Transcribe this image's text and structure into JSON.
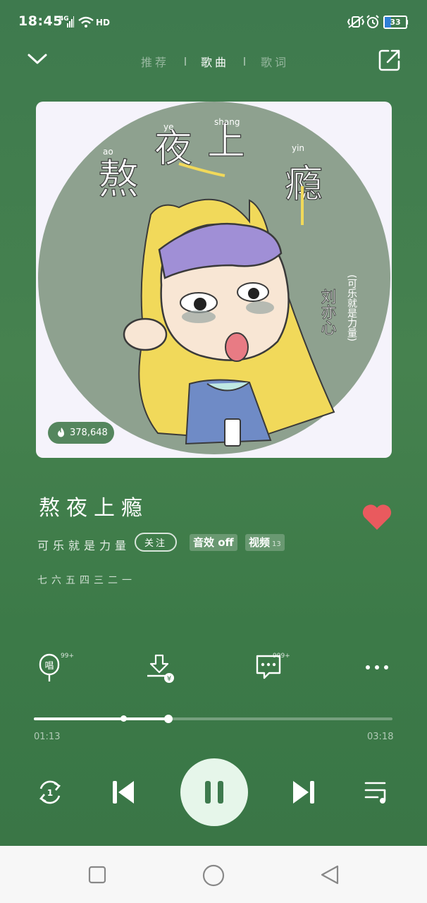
{
  "status_bar": {
    "time": "18:45",
    "network": "4G",
    "wifi_badge": "HD",
    "battery": "33"
  },
  "top_nav": {
    "tabs": [
      {
        "label": "推荐",
        "active": false
      },
      {
        "label": "歌曲",
        "active": true
      },
      {
        "label": "歌词",
        "active": false
      }
    ]
  },
  "cover": {
    "heat_count": "378,648"
  },
  "song": {
    "title": "熬夜上瘾",
    "artist": "可乐就是力量",
    "follow_label": "关注",
    "sound_effect_label": "音效 off",
    "video_label": "视频",
    "video_count": "13",
    "lyric_line": "七六五四三二一"
  },
  "actions": {
    "sing_icon_text": "唱",
    "sing_badge": "99+",
    "comment_badge": "999+"
  },
  "progress": {
    "current": "01:13",
    "total": "03:18",
    "fraction": 0.375
  },
  "colors": {
    "background": "#3e7a4e",
    "like": "#e95a5e",
    "play_button": "#e6f6ea"
  },
  "icons": [
    "chevron-down-icon",
    "share-icon",
    "flame-icon",
    "heart-icon",
    "microphone-icon",
    "download-icon",
    "comment-icon",
    "more-icon",
    "repeat-one-icon",
    "previous-icon",
    "pause-icon",
    "next-icon",
    "playlist-icon",
    "recent-apps-icon",
    "home-icon",
    "back-icon"
  ]
}
